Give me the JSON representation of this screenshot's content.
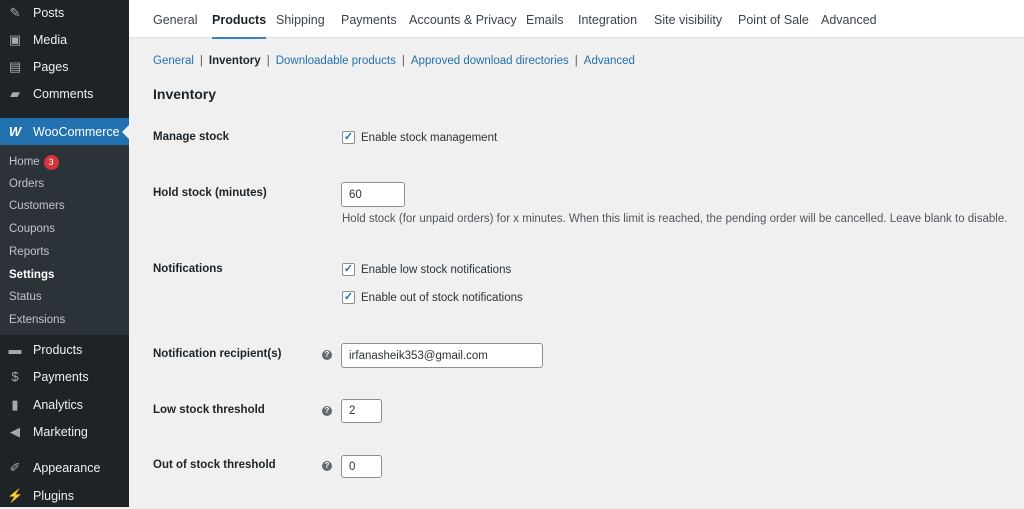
{
  "sidebar": {
    "top_items": [
      {
        "label": "Posts",
        "icon": "pin-icon"
      },
      {
        "label": "Media",
        "icon": "media-icon"
      },
      {
        "label": "Pages",
        "icon": "pages-icon"
      },
      {
        "label": "Comments",
        "icon": "comment-icon"
      }
    ],
    "woocommerce": "WooCommerce",
    "sub_items": [
      {
        "label": "Home",
        "badge": "3"
      },
      {
        "label": "Orders"
      },
      {
        "label": "Customers"
      },
      {
        "label": "Coupons"
      },
      {
        "label": "Reports"
      },
      {
        "label": "Settings",
        "current": true
      },
      {
        "label": "Status"
      },
      {
        "label": "Extensions"
      }
    ],
    "bottom_items": [
      {
        "label": "Products",
        "icon": "archive-icon"
      },
      {
        "label": "Payments",
        "icon": "dollar-icon"
      },
      {
        "label": "Analytics",
        "icon": "bar-chart-icon"
      },
      {
        "label": "Marketing",
        "icon": "megaphone-icon"
      },
      {
        "label": "Appearance",
        "icon": "brush-icon"
      },
      {
        "label": "Plugins",
        "icon": "plug-icon"
      }
    ]
  },
  "tabs": [
    "General",
    "Products",
    "Shipping",
    "Payments",
    "Accounts & Privacy",
    "Emails",
    "Integration",
    "Site visibility",
    "Point of Sale",
    "Advanced"
  ],
  "active_tab": "Products",
  "subnav": [
    "General",
    "Inventory",
    "Downloadable products",
    "Approved download directories",
    "Advanced"
  ],
  "section_title": "Inventory",
  "form": {
    "manage_stock": {
      "label": "Manage stock",
      "checkbox": "Enable stock management",
      "checked": true
    },
    "hold_stock": {
      "label": "Hold stock (minutes)",
      "value": "60",
      "description": "Hold stock (for unpaid orders) for x minutes. When this limit is reached, the pending order will be cancelled. Leave blank to disable."
    },
    "notifications": {
      "label": "Notifications",
      "low": "Enable low stock notifications",
      "low_checked": true,
      "out": "Enable out of stock notifications",
      "out_checked": true
    },
    "recipient": {
      "label": "Notification recipient(s)",
      "value": "irfanasheik353@gmail.com"
    },
    "low_threshold": {
      "label": "Low stock threshold",
      "value": "2"
    },
    "out_threshold": {
      "label": "Out of stock threshold",
      "value": "0"
    }
  },
  "colors": {
    "sidebar": "#1d2327",
    "accent": "#2271b1",
    "badge": "#d63638"
  }
}
